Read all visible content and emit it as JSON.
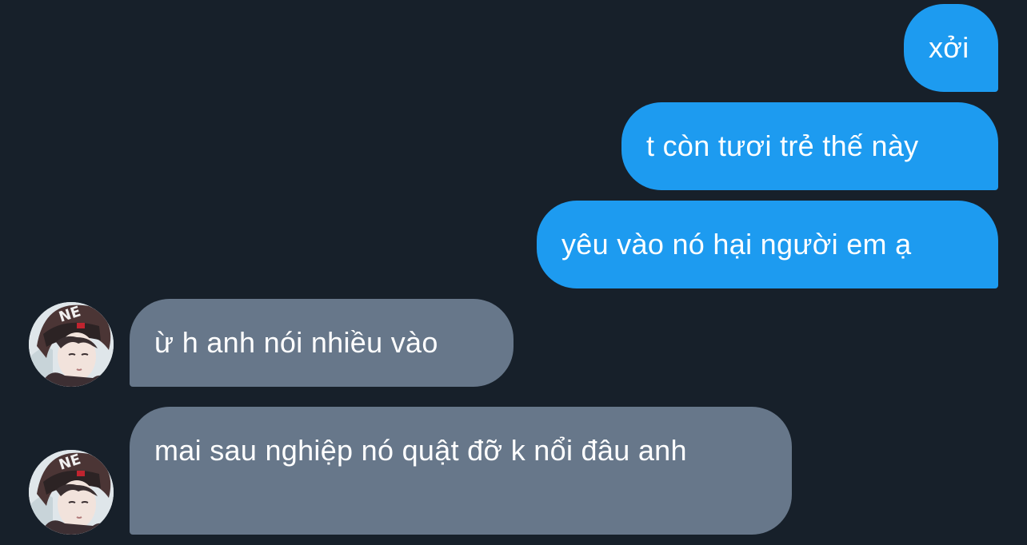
{
  "conversation": {
    "messages": [
      {
        "direction": "outgoing",
        "text": "xởi"
      },
      {
        "direction": "outgoing",
        "text": "t còn tươi trẻ thế này"
      },
      {
        "direction": "outgoing",
        "text": "yêu vào nó hại người em ạ"
      },
      {
        "direction": "incoming",
        "text": "ừ h anh nói nhiều vào"
      },
      {
        "direction": "incoming",
        "text": "mai sau nghiệp nó quật đỡ k nổi đâu anh"
      }
    ]
  },
  "colors": {
    "background": "#17202a",
    "outgoing_bubble": "#1d9bf0",
    "incoming_bubble": "#67778a",
    "text": "#ffffff"
  },
  "avatar": {
    "icon": "user-avatar-photo"
  }
}
